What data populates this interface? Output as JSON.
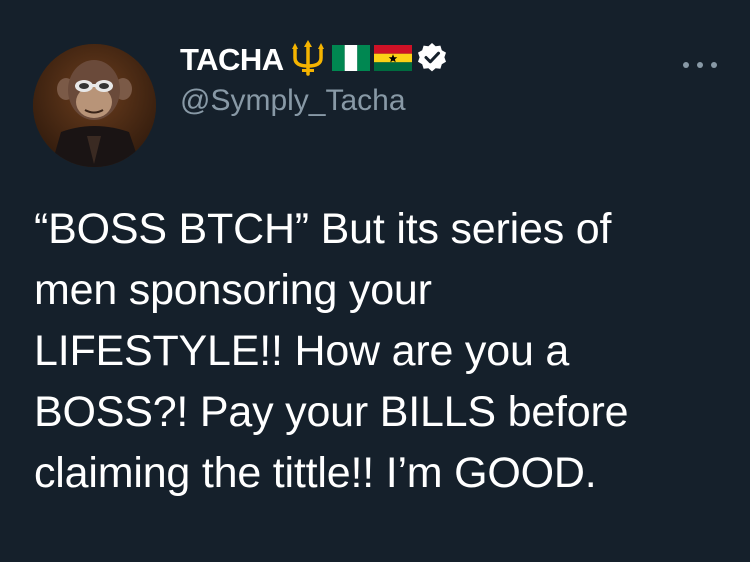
{
  "author": {
    "display_name": "TACHA",
    "handle": "@Symply_Tacha",
    "verified": true,
    "badges": [
      "trident-emoji",
      "nigeria-flag-emoji",
      "ghana-flag-emoji",
      "verified-badge-icon"
    ]
  },
  "tweet": {
    "lines": [
      "“BOSS BTCH” But its series of",
      "men sponsoring your",
      "LIFESTYLE!! How are you a",
      "BOSS?! Pay your BILLS before",
      "claiming the tittle!! I’m GOOD."
    ]
  },
  "colors": {
    "background": "#15202b",
    "text_primary": "#ffffff",
    "text_secondary": "#8899a6",
    "verified_badge": "#ffffff",
    "trident": "#f5b400"
  },
  "icons": {
    "more_menu": "more-options-icon"
  }
}
